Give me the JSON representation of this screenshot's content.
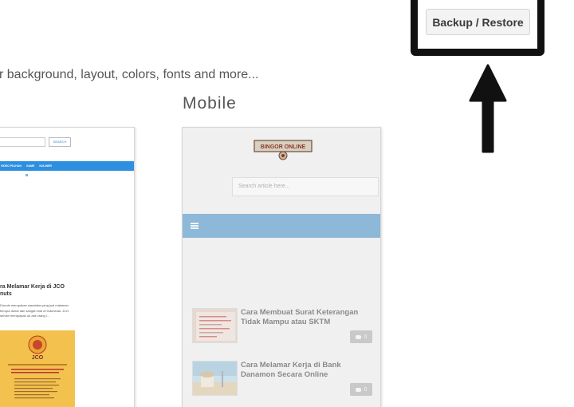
{
  "intro": {
    "text": "r background, layout, colors, fonts and more..."
  },
  "backup": {
    "button_label": "Backup / Restore"
  },
  "arrow": {
    "icon": "up-arrow-icon",
    "color": "#111111"
  },
  "mobile": {
    "heading": "Mobile",
    "logo_text": "BINGOR ONLINE",
    "search_placeholder": "Search article here...",
    "nav_color": "#8eb8d8",
    "posts": [
      {
        "title": "Cara Membuat Surat Keterangan Tidak Mampu atau SKTM",
        "comments": "0"
      },
      {
        "title": "Cara Melamar Kerja di Bank Danamon Secara Online",
        "comments": "0"
      }
    ]
  },
  "desktop": {
    "search_placeholder": "...",
    "search_button": "SEARCH",
    "nav_items": [
      "VIDEO PILIHAN",
      "GAME",
      "KULINER"
    ],
    "nav_color": "#2e8fe0",
    "post_title": "ra Melamar Kerja di JCO nuts",
    "post_excerpt": "Donuts merupakan waralaba yang jual makanan berupa donat dan sangat enal di Indonesia. JCO sendiri merupakan uk asli orang I...",
    "image_label": "JCO"
  }
}
